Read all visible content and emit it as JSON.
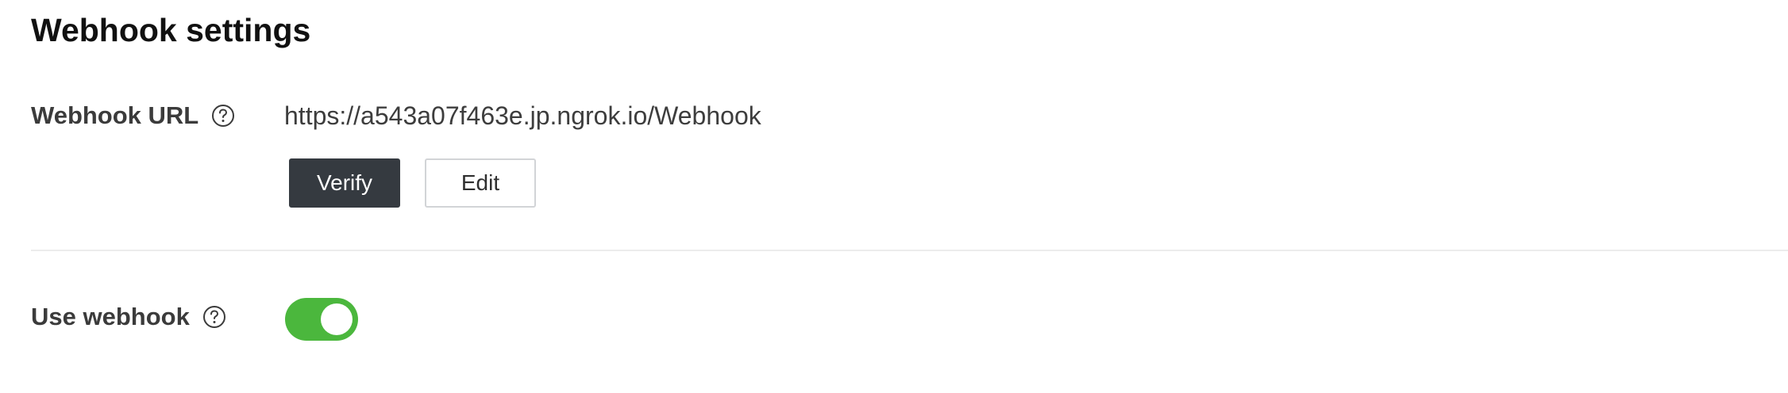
{
  "section": {
    "title": "Webhook settings"
  },
  "webhook_url": {
    "label": "Webhook URL",
    "help_icon": "question-circle-icon",
    "value": "https://a543a07f463e.jp.ngrok.io/Webhook",
    "verify_label": "Verify",
    "edit_label": "Edit"
  },
  "use_webhook": {
    "label": "Use webhook",
    "help_icon": "question-circle-icon",
    "enabled": true
  },
  "colors": {
    "toggle_on": "#4bb73d",
    "verify_button": "#353a40",
    "divider": "#ececec"
  }
}
